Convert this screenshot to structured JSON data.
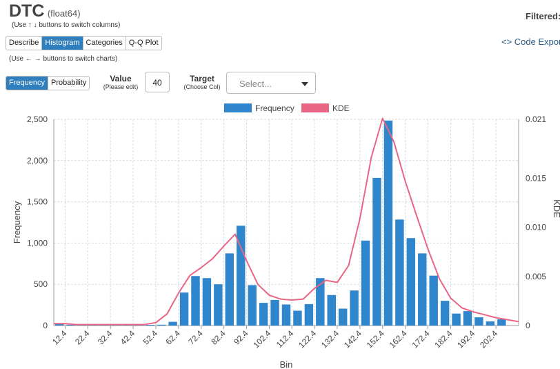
{
  "header": {
    "column_name": "DTC",
    "dtype": "(float64)",
    "column_hint": "(Use ↑ ↓ buttons to switch columns)",
    "chart_hint": "(Use ← → buttons to switch charts)",
    "filtered_label": "Filtered:",
    "code_export_label": "<> Code Export"
  },
  "tabs": [
    "Describe",
    "Histogram",
    "Categories",
    "Q-Q Plot"
  ],
  "active_tab": "Histogram",
  "mode_buttons": [
    "Frequency",
    "Probability"
  ],
  "active_mode": "Frequency",
  "value_control": {
    "label": "Value",
    "sublabel": "(Please edit)",
    "value": "40"
  },
  "target_control": {
    "label": "Target",
    "sublabel": "(Choose Col)",
    "placeholder": "Select..."
  },
  "chart_data": {
    "type": "bar",
    "xlabel": "Bin",
    "ylabel": "Frequency",
    "y2label": "KDE",
    "legend": [
      {
        "name": "Frequency",
        "color": "#2f86cc"
      },
      {
        "name": "KDE",
        "color": "#e86584"
      }
    ],
    "legend_position": "top-center",
    "ylim": [
      0,
      2500
    ],
    "y2lim": [
      0,
      0.021
    ],
    "yticks": [
      "0",
      "500",
      "1,000",
      "1,500",
      "2,000",
      "2,500"
    ],
    "y2ticks": [
      "0",
      "0.005",
      "0.010",
      "0.015",
      "0.021"
    ],
    "xtick_labels": [
      "12.4",
      "22.4",
      "32.4",
      "42.4",
      "52.4",
      "62.4",
      "72.4",
      "82.4",
      "92.4",
      "102.4",
      "112.4",
      "122.4",
      "132.4",
      "142.4",
      "152.4",
      "162.4",
      "172.4",
      "182.4",
      "192.4",
      "202.4"
    ],
    "xlim": [
      7.4,
      212.4
    ],
    "bin_width": 5,
    "bin_starts": [
      7.4,
      12.4,
      17.4,
      22.4,
      27.4,
      32.4,
      37.4,
      42.4,
      47.4,
      52.4,
      57.4,
      62.4,
      67.4,
      72.4,
      77.4,
      82.4,
      87.4,
      92.4,
      97.4,
      102.4,
      107.4,
      112.4,
      117.4,
      122.4,
      127.4,
      132.4,
      137.4,
      142.4,
      147.4,
      152.4,
      157.4,
      162.4,
      167.4,
      172.4,
      177.4,
      182.4,
      187.4,
      192.4,
      197.4,
      202.4
    ],
    "values": [
      30,
      10,
      10,
      10,
      8,
      8,
      8,
      8,
      8,
      10,
      45,
      400,
      600,
      575,
      500,
      875,
      1210,
      490,
      275,
      310,
      255,
      180,
      260,
      575,
      370,
      205,
      425,
      1030,
      1790,
      2485,
      1285,
      1060,
      875,
      605,
      300,
      145,
      175,
      100,
      50,
      75
    ],
    "kde_x": [
      7.4,
      12.4,
      17.4,
      22.4,
      27.4,
      32.4,
      37.4,
      42.4,
      47.4,
      52.4,
      57.4,
      62.4,
      67.4,
      72.4,
      77.4,
      82.4,
      87.4,
      92.4,
      97.4,
      102.4,
      107.4,
      112.4,
      117.4,
      122.4,
      127.4,
      132.4,
      137.4,
      142.4,
      147.4,
      152.4,
      157.4,
      162.4,
      167.4,
      172.4,
      177.4,
      182.4,
      187.4,
      192.4,
      197.4,
      202.4,
      207.4,
      212.4
    ],
    "kde_y": [
      0.0002,
      0.0002,
      0.0001,
      0.0001,
      0.0001,
      0.0001,
      0.0001,
      0.0001,
      0.0001,
      0.0003,
      0.0012,
      0.0033,
      0.0051,
      0.0059,
      0.0068,
      0.0081,
      0.0093,
      0.0066,
      0.0042,
      0.0031,
      0.0027,
      0.0026,
      0.0027,
      0.0038,
      0.0046,
      0.0044,
      0.0061,
      0.0109,
      0.0171,
      0.0211,
      0.0187,
      0.0147,
      0.0112,
      0.0078,
      0.0048,
      0.0028,
      0.0018,
      0.0014,
      0.0011,
      0.0008,
      0.0006,
      0.0004
    ]
  }
}
